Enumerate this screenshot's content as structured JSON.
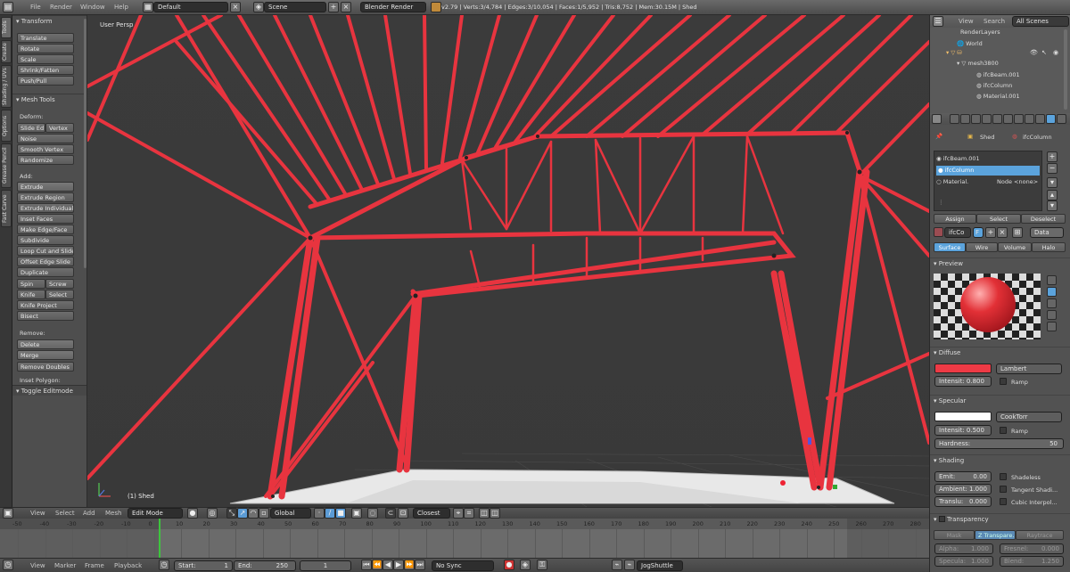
{
  "menu": {
    "file": "File",
    "render": "Render",
    "window": "Window",
    "help": "Help"
  },
  "top": {
    "layout": "Default",
    "scene": "Scene",
    "engine": "Blender Render",
    "stats": "v2.79 | Verts:3/4,784 | Edges:3/10,054 | Faces:1/5,952 | Tris:8,752 | Mem:30.15M | Shed"
  },
  "vtabs": [
    "Tools",
    "Create",
    "Shading / UVs",
    "Options",
    "Grease Pencil",
    "Fast Carve"
  ],
  "toolshelf": {
    "transform_title": "Transform",
    "translate": "Translate",
    "rotate": "Rotate",
    "scale": "Scale",
    "shrink": "Shrink/Fatten",
    "pushpull": "Push/Pull",
    "mesh_tools_title": "Mesh Tools",
    "deform": "Deform:",
    "slide_edge": "Slide Ed",
    "vertex": "Vertex",
    "noise": "Noise",
    "smooth_vertex": "Smooth Vertex",
    "randomize": "Randomize",
    "add": "Add:",
    "extrude": "Extrude",
    "extrude_region": "Extrude Region",
    "extrude_individual": "Extrude Individual",
    "inset_faces": "Inset Faces",
    "make_edge_face": "Make Edge/Face",
    "subdivide": "Subdivide",
    "loop_cut": "Loop Cut and Slide",
    "offset_edge": "Offset Edge Slide",
    "duplicate": "Duplicate",
    "spin": "Spin",
    "screw": "Screw",
    "knife": "Knife",
    "select": "Select",
    "knife_project": "Knife Project",
    "bisect": "Bisect",
    "remove": "Remove:",
    "delete": "Delete",
    "merge": "Merge",
    "remove_doubles": "Remove Doubles",
    "inset_polygon": "Inset Polygon:",
    "toggle_editmode": "Toggle Editmode"
  },
  "viewport": {
    "label": "User Persp",
    "object_label": "(1) Shed"
  },
  "v3d_header": {
    "view": "View",
    "select": "Select",
    "add": "Add",
    "mesh": "Mesh",
    "mode": "Edit Mode",
    "orientation": "Global",
    "snap": "Closest"
  },
  "timeline": {
    "ticks": [
      "-50",
      "-40",
      "-30",
      "-20",
      "-10",
      "0",
      "10",
      "20",
      "30",
      "40",
      "50",
      "60",
      "70",
      "80",
      "90",
      "100",
      "110",
      "120",
      "130",
      "140",
      "150",
      "160",
      "170",
      "180",
      "190",
      "200",
      "210",
      "220",
      "230",
      "240",
      "250",
      "260",
      "270",
      "280"
    ]
  },
  "tl_header": {
    "view": "View",
    "marker": "Marker",
    "frame": "Frame",
    "playback": "Playback",
    "start": "Start:",
    "start_val": "1",
    "end": "End:",
    "end_val": "250",
    "current": "1",
    "sync": "No Sync",
    "keying": "JogShuttle"
  },
  "outliner": {
    "view": "View",
    "search": "Search",
    "all_scenes": "All Scenes",
    "items": [
      "RenderLayers",
      "World",
      "mesh3800",
      "ifcBeam.001",
      "ifcColumn",
      "Material.001"
    ]
  },
  "properties": {
    "breadcrumb_obj": "Shed",
    "breadcrumb_mat": "ifcColumn",
    "slots": [
      "ifcBeam.001",
      "ifcColumn",
      "Material."
    ],
    "node_label": "Node <none>",
    "assign": "Assign",
    "select": "Select",
    "deselect": "Deselect",
    "material_name": "ifcCo",
    "users": "F",
    "data": "Data",
    "tabs": [
      "Surface",
      "Wire",
      "Volume",
      "Halo"
    ],
    "preview": "Preview",
    "diffuse": "Diffuse",
    "diffuse_shader": "Lambert",
    "diffuse_intensity": "Intensit: 0.800",
    "ramp": "Ramp",
    "specular": "Specular",
    "spec_shader": "CookTorr",
    "spec_intensity": "Intensit: 0.500",
    "hardness_label": "Hardness:",
    "hardness": "50",
    "shading": "Shading",
    "emit": "Emit:",
    "emit_val": "0.00",
    "shadeless": "Shadeless",
    "ambient": "Ambient:",
    "ambient_val": "1.000",
    "tangent": "Tangent Shadi...",
    "translucency": "Translu:",
    "translucency_val": "0.000",
    "cubic": "Cubic Interpol...",
    "transparency": "Transparency",
    "mask": "Mask",
    "ztransp": "Z Transpare...",
    "raytrace": "Raytrace",
    "alpha": "Alpha:",
    "alpha_val": "1.000",
    "fresnel": "Fresnel:",
    "fresnel_val": "0.000",
    "specular_lbl": "Specula:",
    "specular_val": "1.000",
    "blend": "Blend:",
    "blend_val": "1.250"
  },
  "colors": {
    "diffuse": "#ee3a45",
    "specular": "#ffffff",
    "selected": "#5ba3dc",
    "frame_red": "#e8343f"
  }
}
